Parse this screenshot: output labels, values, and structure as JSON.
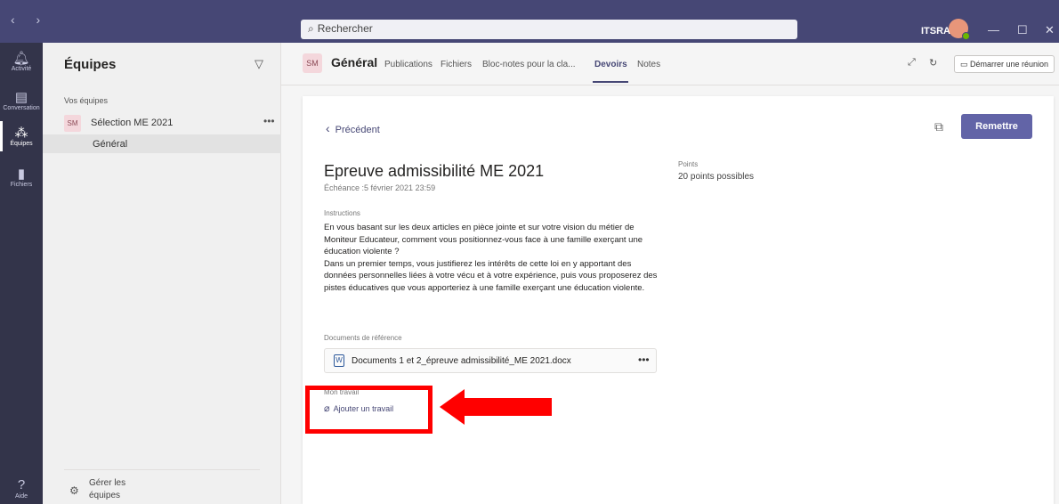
{
  "titlebar": {
    "search_placeholder": "Rechercher",
    "user_initials": "ITSRA",
    "colors": {
      "bar": "#464775",
      "avatar": "#e8967a",
      "presence": "#6bb700"
    }
  },
  "rail": {
    "items": [
      {
        "label": "Activité",
        "icon": "bell-icon"
      },
      {
        "label": "Conversation",
        "icon": "chat-icon"
      },
      {
        "label": "Équipes",
        "icon": "teams-icon",
        "active": true
      },
      {
        "label": "Fichiers",
        "icon": "file-icon"
      }
    ],
    "help_label": "Aide"
  },
  "panel": {
    "title": "Équipes",
    "section_label": "Vos équipes",
    "team": {
      "badge": "SM",
      "name": "Sélection ME 2021",
      "more": "•••"
    },
    "channel": "Général",
    "manage_label": "Gérer les équipes"
  },
  "channel_header": {
    "badge": "SM",
    "title": "Général",
    "tabs": [
      {
        "label": "Publications"
      },
      {
        "label": "Fichiers"
      },
      {
        "label": "Bloc-notes pour la cla..."
      },
      {
        "label": "Devoirs",
        "active": true
      },
      {
        "label": "Notes"
      }
    ],
    "meeting_button": "Démarrer une réunion"
  },
  "assignment": {
    "back_label": "Précédent",
    "submit_label": "Remettre",
    "title": "Epreuve admissibilité ME 2021",
    "due": "Échéance :5 février 2021 23:59",
    "points_label": "Points",
    "points_value": "20 points possibles",
    "instructions_label": "Instructions",
    "instructions_p1": "En vous basant sur les deux articles en pièce jointe et sur votre vision du métier de Moniteur Educateur, comment vous positionnez-vous face à une famille exerçant une éducation violente ?",
    "instructions_p2": "Dans un premier temps, vous justifierez les intérêts de cette loi en y apportant des données personnelles liées à votre vécu et à votre expérience, puis vous proposerez des pistes éducatives que vous apporteriez à une famille exerçant une éducation violente.",
    "docs_label": "Documents de référence",
    "doc_name": "Documents 1 et 2_épreuve admissibilité_ME 2021.docx",
    "doc_more": "•••",
    "work_label": "Mon travail",
    "add_work_label": "Ajouter un travail"
  },
  "annotation": {
    "color": "#ff0000"
  }
}
